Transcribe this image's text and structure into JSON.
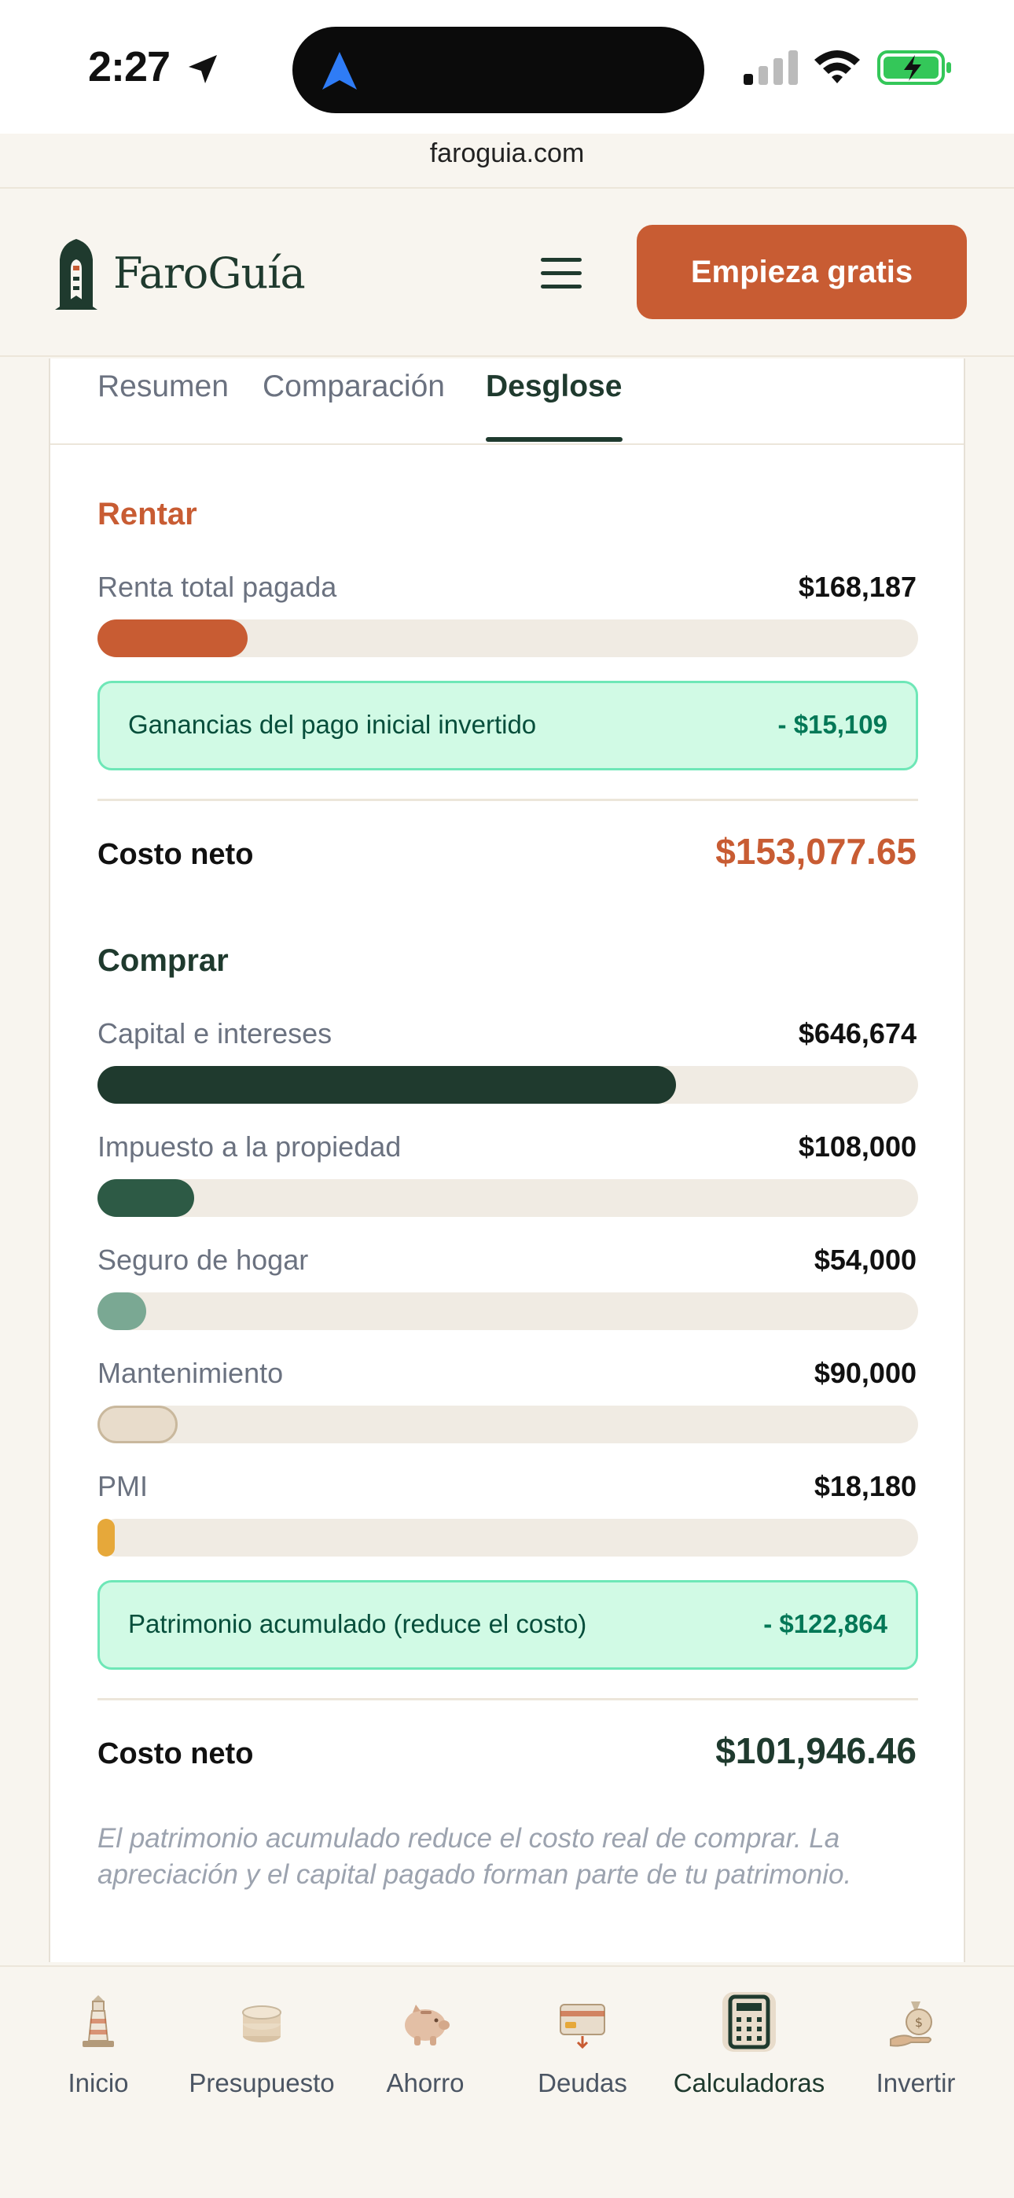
{
  "status_bar": {
    "time": "2:27"
  },
  "browser": {
    "url": "faroguia.com"
  },
  "header": {
    "brand": "FaroGuía",
    "cta_label": "Empieza gratis"
  },
  "tabs": [
    {
      "label": "Resumen",
      "active": false
    },
    {
      "label": "Comparación",
      "active": false
    },
    {
      "label": "Desglose",
      "active": true
    }
  ],
  "rent": {
    "title": "Rentar",
    "title_color": "#c85c33",
    "rows": [
      {
        "label": "Renta total pagada",
        "value": "$168,187",
        "fill_fraction": 0.183,
        "color": "#c85c33"
      }
    ],
    "gain": {
      "label": "Ganancias del pago inicial invertido",
      "value": "- $15,109"
    },
    "net": {
      "label": "Costo neto",
      "value": "$153,077.65",
      "color": "#c85c33"
    }
  },
  "buy": {
    "title": "Comprar",
    "title_color": "#1f3a2e",
    "rows": [
      {
        "label": "Capital e intereses",
        "value": "$646,674",
        "fill_fraction": 0.705,
        "color": "#1f3a2e"
      },
      {
        "label": "Impuesto a la propiedad",
        "value": "$108,000",
        "fill_fraction": 0.118,
        "color": "#2d5a45"
      },
      {
        "label": "Seguro de hogar",
        "value": "$54,000",
        "fill_fraction": 0.059,
        "color": "#7aa893"
      },
      {
        "label": "Mantenimiento",
        "value": "$90,000",
        "fill_fraction": 0.098,
        "color": "#e8dccb"
      },
      {
        "label": "PMI",
        "value": "$18,180",
        "fill_fraction": 0.02,
        "color": "#e6a83a"
      }
    ],
    "gain": {
      "label": "Patrimonio acumulado (reduce el costo)",
      "value": "- $122,864"
    },
    "net": {
      "label": "Costo neto",
      "value": "$101,946.46",
      "color": "#1f3a2e"
    },
    "note": "El patrimonio acumulado reduce el costo real de comprar. La apreciación y el capital pagado forman parte de tu patrimonio."
  },
  "bottom_nav": [
    {
      "label": "Inicio",
      "icon": "lighthouse-icon",
      "active": false
    },
    {
      "label": "Presupuesto",
      "icon": "coins-icon",
      "active": false
    },
    {
      "label": "Ahorro",
      "icon": "piggy-bank-icon",
      "active": false
    },
    {
      "label": "Deudas",
      "icon": "credit-card-icon",
      "active": false
    },
    {
      "label": "Calculadoras",
      "icon": "calculator-icon",
      "active": true
    },
    {
      "label": "Invertir",
      "icon": "money-bag-icon",
      "active": false
    }
  ]
}
